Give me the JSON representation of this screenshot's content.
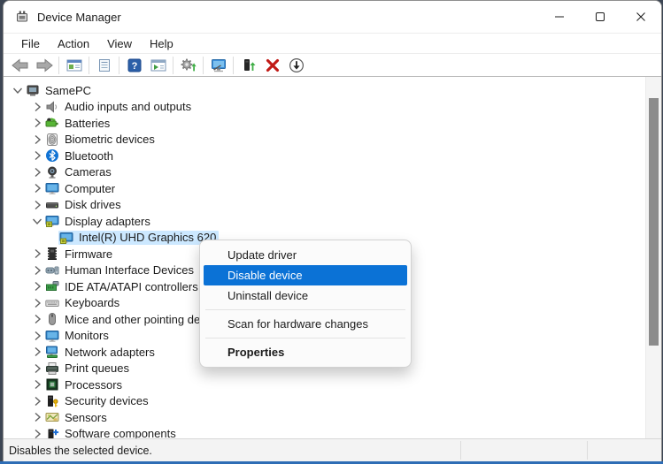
{
  "window": {
    "title": "Device Manager",
    "icon": "device-manager-icon",
    "controls": [
      {
        "name": "minimize-button",
        "icon": "minimize-icon"
      },
      {
        "name": "maximize-button",
        "icon": "maximize-icon"
      },
      {
        "name": "close-button",
        "icon": "close-icon"
      }
    ]
  },
  "menu_bar": {
    "items": [
      {
        "label": "File"
      },
      {
        "label": "Action"
      },
      {
        "label": "View"
      },
      {
        "label": "Help"
      }
    ]
  },
  "toolbar": {
    "buttons": [
      {
        "name": "back-button",
        "icon": "back-arrow-icon"
      },
      {
        "name": "forward-button",
        "icon": "forward-arrow-icon"
      },
      {
        "separator": true
      },
      {
        "name": "show-console-tree-button",
        "icon": "console-tree-icon"
      },
      {
        "separator": true
      },
      {
        "name": "properties-button",
        "icon": "properties-icon"
      },
      {
        "separator": true
      },
      {
        "name": "help-button",
        "icon": "help-icon"
      },
      {
        "name": "action-pane-button",
        "icon": "action-pane-icon"
      },
      {
        "separator": true
      },
      {
        "name": "update-driver-button",
        "icon": "update-driver-icon"
      },
      {
        "separator": true
      },
      {
        "name": "scan-hardware-button",
        "icon": "scan-monitor-icon"
      },
      {
        "separator": true
      },
      {
        "name": "add-driver-button",
        "icon": "driver-tower-icon"
      },
      {
        "name": "uninstall-device-button",
        "icon": "uninstall-x-icon"
      },
      {
        "name": "disable-device-button",
        "icon": "disable-circle-icon"
      }
    ]
  },
  "tree": {
    "items": [
      {
        "label": "SamePC",
        "icon": "pc-icon",
        "depth": 0,
        "chevron": "expanded"
      },
      {
        "label": "Audio inputs and outputs",
        "icon": "speaker-icon",
        "depth": 1,
        "chevron": "collapsed"
      },
      {
        "label": "Batteries",
        "icon": "battery-icon",
        "depth": 1,
        "chevron": "collapsed"
      },
      {
        "label": "Biometric devices",
        "icon": "fingerprint-icon",
        "depth": 1,
        "chevron": "collapsed"
      },
      {
        "label": "Bluetooth",
        "icon": "bluetooth-icon",
        "depth": 1,
        "chevron": "collapsed"
      },
      {
        "label": "Cameras",
        "icon": "webcam-icon",
        "depth": 1,
        "chevron": "collapsed"
      },
      {
        "label": "Computer",
        "icon": "monitor-icon",
        "depth": 1,
        "chevron": "collapsed"
      },
      {
        "label": "Disk drives",
        "icon": "disk-icon",
        "depth": 1,
        "chevron": "collapsed"
      },
      {
        "label": "Display adapters",
        "icon": "display-adapter-icon",
        "depth": 1,
        "chevron": "expanded"
      },
      {
        "label": "Intel(R) UHD Graphics 620",
        "icon": "display-adapter-icon",
        "depth": 2,
        "chevron": "none",
        "selected": true
      },
      {
        "label": "Firmware",
        "icon": "firmware-icon",
        "depth": 1,
        "chevron": "collapsed"
      },
      {
        "label": "Human Interface Devices",
        "icon": "hid-icon",
        "depth": 1,
        "chevron": "collapsed"
      },
      {
        "label": "IDE ATA/ATAPI controllers",
        "icon": "ide-icon",
        "depth": 1,
        "chevron": "collapsed"
      },
      {
        "label": "Keyboards",
        "icon": "keyboard-icon",
        "depth": 1,
        "chevron": "collapsed"
      },
      {
        "label": "Mice and other pointing devices",
        "icon": "mouse-icon",
        "depth": 1,
        "chevron": "collapsed"
      },
      {
        "label": "Monitors",
        "icon": "monitor-icon",
        "depth": 1,
        "chevron": "collapsed"
      },
      {
        "label": "Network adapters",
        "icon": "network-icon",
        "depth": 1,
        "chevron": "collapsed"
      },
      {
        "label": "Print queues",
        "icon": "printer-icon",
        "depth": 1,
        "chevron": "collapsed"
      },
      {
        "label": "Processors",
        "icon": "processor-icon",
        "depth": 1,
        "chevron": "collapsed"
      },
      {
        "label": "Security devices",
        "icon": "security-icon",
        "depth": 1,
        "chevron": "collapsed"
      },
      {
        "label": "Sensors",
        "icon": "sensor-icon",
        "depth": 1,
        "chevron": "collapsed"
      },
      {
        "label": "Software components",
        "icon": "software-icon",
        "depth": 1,
        "chevron": "collapsed"
      }
    ]
  },
  "context_menu": {
    "items": [
      {
        "label": "Update driver"
      },
      {
        "label": "Disable device",
        "highlighted": true
      },
      {
        "label": "Uninstall device"
      },
      {
        "separator": true
      },
      {
        "label": "Scan for hardware changes"
      },
      {
        "separator": true
      },
      {
        "label": "Properties",
        "bold": true
      }
    ]
  },
  "status_bar": {
    "text": "Disables the selected device."
  },
  "colors": {
    "menu_highlight": "#0b72d6",
    "menu_highlight_text": "#ffffff",
    "tree_selection": "#cce8ff",
    "titlebar_bg": "#ffffff",
    "statusbar_bg": "#f3f3f3"
  }
}
